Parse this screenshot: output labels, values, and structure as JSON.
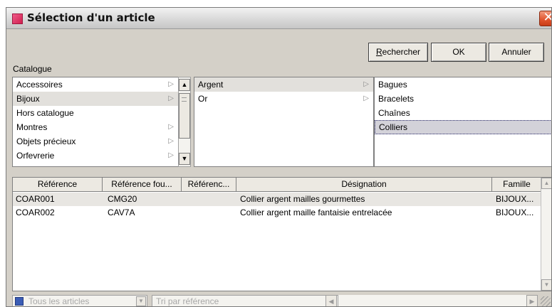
{
  "window": {
    "title": "Sélection d'un article",
    "close_glyph": "✕"
  },
  "buttons": {
    "search_u": "R",
    "search_rest": "echercher",
    "ok": "OK",
    "cancel": "Annuler"
  },
  "catalogue": {
    "label": "Catalogue",
    "col1": [
      {
        "label": "Accessoires",
        "arrow": "▷"
      },
      {
        "label": "Bijoux",
        "arrow": "▷"
      },
      {
        "label": "Hors catalogue",
        "arrow": ""
      },
      {
        "label": "Montres",
        "arrow": "▷"
      },
      {
        "label": "Objets précieux",
        "arrow": "▷"
      },
      {
        "label": "Orfevrerie",
        "arrow": "▷"
      }
    ],
    "col2": [
      {
        "label": "Argent",
        "arrow": "▷"
      },
      {
        "label": "Or",
        "arrow": "▷"
      }
    ],
    "col3": [
      "Bagues",
      "Bracelets",
      "Chaînes",
      "Colliers"
    ]
  },
  "grid": {
    "headers": [
      "Référence",
      "Référence fou...",
      "Référenc...",
      "Désignation",
      "Famille"
    ],
    "rows": [
      [
        "COAR001",
        "CMG20",
        "",
        "Collier argent mailles gourmettes",
        "BIJOUX..."
      ],
      [
        "COAR002",
        "CAV7A",
        "",
        "Collier argent maille fantaisie entrelacée",
        "BIJOUX..."
      ]
    ]
  },
  "bottom": {
    "filter_articles": "Tous les articles",
    "sort": "Tri par référence"
  },
  "icons": {
    "up": "▲",
    "down": "▼",
    "left": "◀",
    "right": "▶",
    "dropdown": "▼",
    "grip": "≡"
  }
}
